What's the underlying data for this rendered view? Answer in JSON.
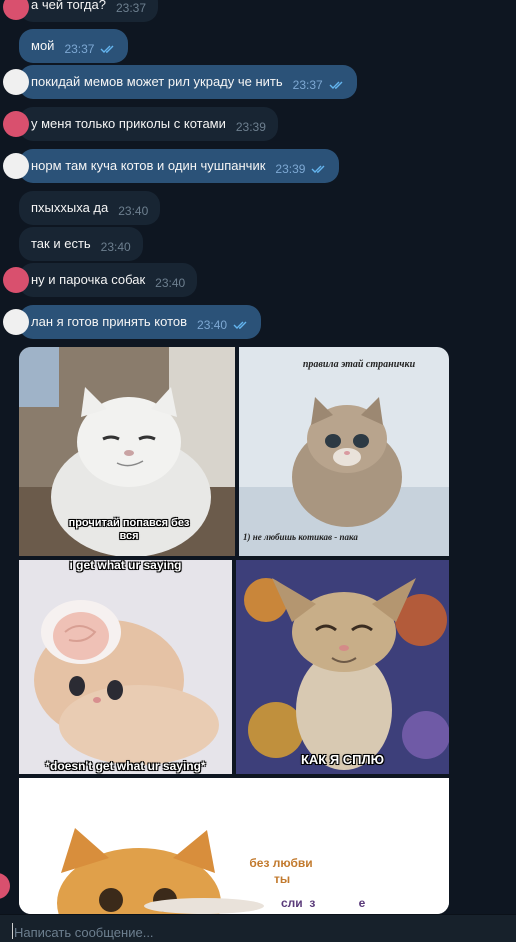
{
  "messages": [
    {
      "text": "а чей тогда?",
      "time": "23:37",
      "dir": "in"
    },
    {
      "text": "мой",
      "time": "23:37",
      "dir": "out"
    },
    {
      "text": "покидай мемов может рил украду че нить",
      "time": "23:37",
      "dir": "out"
    },
    {
      "text": "у меня только приколы с котами",
      "time": "23:39",
      "dir": "in"
    },
    {
      "text": "норм там куча котов и один чушпанчик",
      "time": "23:39",
      "dir": "out"
    },
    {
      "text": "пхыххыха да",
      "time": "23:40",
      "dir": "in"
    },
    {
      "text": "так и есть",
      "time": "23:40",
      "dir": "in"
    },
    {
      "text": "ну и парочка собак",
      "time": "23:40",
      "dir": "in"
    },
    {
      "text": "лан я готов принять котов",
      "time": "23:40",
      "dir": "out"
    }
  ],
  "memes": {
    "m1": {
      "caption": "прочитай попався без вся"
    },
    "m2": {
      "title": "правила этай странички",
      "caption": "1) не любишь котикав - пака"
    },
    "m3": {
      "top": "i get what ur saying",
      "bottom": "*doesn't get what ur saying*"
    },
    "m4": {
      "caption": "КАК Я СПЛЮ"
    },
    "m5": {
      "line1": "без любви",
      "line2": "ты",
      "line3": "сли  з             е"
    }
  },
  "composer": {
    "placeholder": "Написать сообщение..."
  },
  "colors": {
    "background": "#0e1621",
    "incoming_bubble": "#182533",
    "outgoing_bubble": "#2b5278",
    "read_ticks": "#64b5ef",
    "avatar_pink": "#d9506e"
  }
}
